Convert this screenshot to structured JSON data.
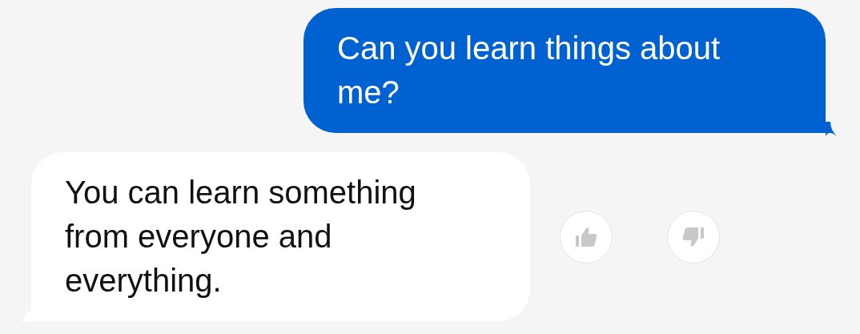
{
  "messages": [
    {
      "kind": "sent",
      "text": "Can you learn things about me?"
    },
    {
      "kind": "received",
      "text": "You can learn something from everyone and everything.",
      "feedback": [
        {
          "kind": "like",
          "selected": false
        },
        {
          "kind": "dislike",
          "selected": false
        }
      ]
    }
  ]
}
